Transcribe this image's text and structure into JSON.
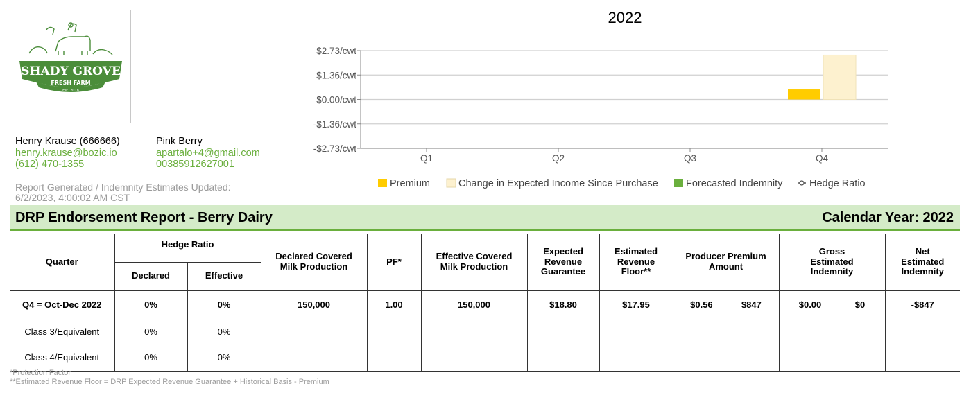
{
  "logo": {
    "name": "SHADY GROVE",
    "sub": "FRESH FARM",
    "est": "Est. 2018",
    "color": "#4b8d3a"
  },
  "contacts": [
    {
      "name": "Henry Krause (666666)",
      "email": "henry.krause@bozic.io",
      "phone": "(612) 470-1355"
    },
    {
      "name": "Pink Berry",
      "email": "apartalo+4@gmail.com",
      "phone": "00385912627001"
    }
  ],
  "report_generated": {
    "label": "Report Generated / Indemnity Estimates Updated:",
    "value": "6/2/2023, 4:00:02 AM CST"
  },
  "chart_data": {
    "type": "bar",
    "title": "2022",
    "categories": [
      "Q1",
      "Q2",
      "Q3",
      "Q4"
    ],
    "y_ticks": [
      "$2.73/cwt",
      "$1.36/cwt",
      "$0.00/cwt",
      "-$1.36/cwt",
      "-$2.73/cwt"
    ],
    "ylim": [
      -2.73,
      2.73
    ],
    "series": [
      {
        "name": "Premium",
        "color": "#ffcc00",
        "values": [
          0,
          0,
          0,
          0.56
        ]
      },
      {
        "name": "Change in Expected Income Since Purchase",
        "color": "#fdf1cf",
        "values": [
          0,
          0,
          0,
          2.48
        ]
      },
      {
        "name": "Forecasted Indemnity",
        "color": "#6aaf3d",
        "values": [
          0,
          0,
          0,
          0
        ]
      },
      {
        "name": "Hedge Ratio",
        "color": "#555555",
        "values": [
          0,
          0,
          0,
          0
        ]
      }
    ],
    "legend_position": "bottom"
  },
  "banner": {
    "title": "DRP Endorsement Report - Berry Dairy",
    "year": "Calendar Year: 2022"
  },
  "table": {
    "headers": {
      "quarter": "Quarter",
      "hedge_ratio": "Hedge Ratio",
      "declared": "Declared",
      "effective": "Effective",
      "declared_covered": "Declared Covered Milk Production",
      "pf": "PF*",
      "effective_covered": "Effective Covered Milk Production",
      "expected_revenue": "Expected Revenue Guarantee",
      "estimated_floor": "Estimated Revenue Floor**",
      "producer_premium": "Producer Premium Amount",
      "gross_indemnity": "Gross Estimated Indemnity",
      "net_indemnity": "Net Estimated Indemnity"
    },
    "rows": [
      {
        "quarter": "Q4 = Oct-Dec 2022",
        "declared": "0%",
        "effective": "0%",
        "declared_covered": "150,000",
        "pf": "1.00",
        "effective_covered": "150,000",
        "expected_revenue": "$18.80",
        "estimated_floor": "$17.95",
        "premium_cwt": "$0.56",
        "premium_total": "$847",
        "gross_cwt": "$0.00",
        "gross_total": "$0",
        "net": "-$847"
      },
      {
        "quarter": "Class 3/Equivalent",
        "declared": "0%",
        "effective": "0%"
      },
      {
        "quarter": "Class 4/Equivalent",
        "declared": "0%",
        "effective": "0%"
      }
    ]
  },
  "footnotes": [
    "*Protection Factor",
    "**Estimated Revenue Floor = DRP Expected Revenue Guarantee + Historical Basis - Premium"
  ]
}
